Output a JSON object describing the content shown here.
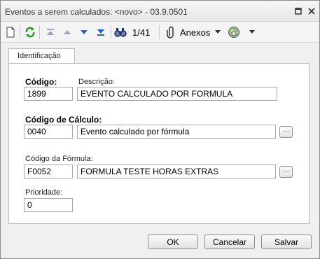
{
  "window": {
    "title": "Eventos a serem calculados: <novo> - 03.9.0501"
  },
  "toolbar": {
    "record_position": "1/41",
    "attachments_label": "Anexos"
  },
  "tabs": [
    {
      "label": "Identificação"
    }
  ],
  "form": {
    "codigo_label": "Código:",
    "codigo_value": "1899",
    "descricao_label": "Descrição:",
    "descricao_value": "EVENTO CALCULADO POR FORMULA",
    "codigo_calculo_label": "Código de Cálculo:",
    "codigo_calculo_value": "0040",
    "codigo_calculo_desc": "Evento calculado por fórmula",
    "codigo_formula_label": "Código da Fórmula:",
    "codigo_formula_value": "F0052",
    "codigo_formula_desc": "FORMULA TESTE HORAS EXTRAS",
    "prioridade_label": "Prioridade:",
    "prioridade_value": "0",
    "lookup_label": "..."
  },
  "footer": {
    "ok": "OK",
    "cancel": "Cancelar",
    "save": "Salvar"
  }
}
